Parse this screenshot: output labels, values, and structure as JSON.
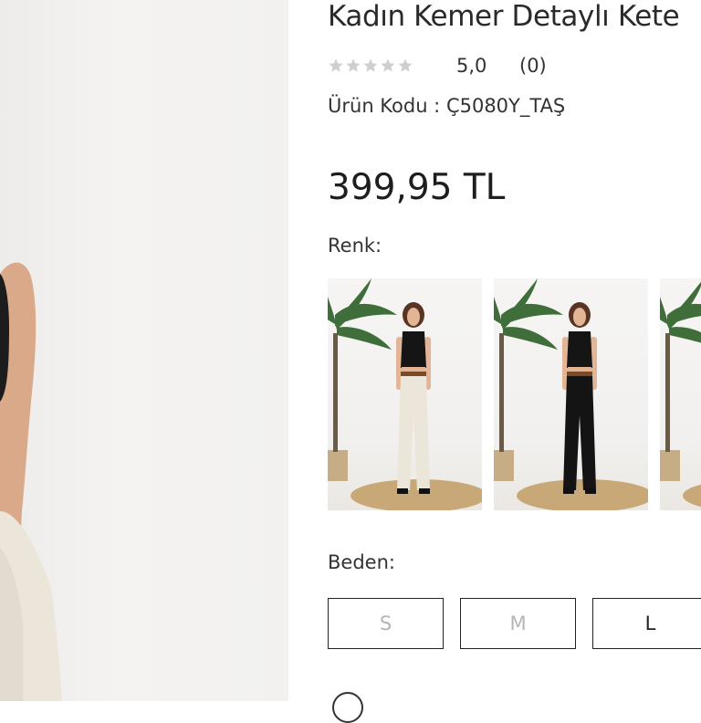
{
  "product": {
    "title": "Kadın Kemer Detaylı Kete",
    "rating_value": "5,0",
    "rating_count": "(0)",
    "star_count": 5,
    "code_text": "Ürün Kodu : Ç5080Y_TAŞ",
    "price": "399,95 TL"
  },
  "color": {
    "label": "Renk:",
    "swatches": [
      {
        "name": "taş",
        "top": "#151515",
        "pants": "#ece6da"
      },
      {
        "name": "siyah",
        "top": "#151515",
        "pants": "#141414"
      },
      {
        "name": "third",
        "top": "#151515",
        "pants": "#8a6a4b"
      }
    ]
  },
  "size": {
    "label": "Beden:",
    "options": [
      {
        "label": "S",
        "available": false
      },
      {
        "label": "M",
        "available": false
      },
      {
        "label": "L",
        "available": true
      }
    ]
  },
  "colors": {
    "star_inactive": "#cfcfcf",
    "border": "#222222",
    "disabled_text": "#b5b5b5"
  }
}
